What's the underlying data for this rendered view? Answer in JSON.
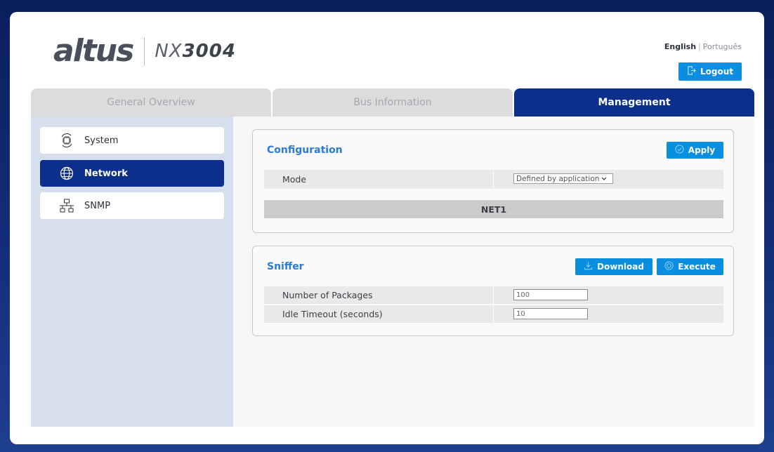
{
  "header": {
    "logo_word": "altus",
    "model_prefix": "NX",
    "model_number": "3004",
    "languages": [
      "English",
      "Português"
    ],
    "logout_label": "Logout"
  },
  "tabs": [
    {
      "label": "General Overview",
      "active": false
    },
    {
      "label": "Bus Information",
      "active": false
    },
    {
      "label": "Management",
      "active": true
    }
  ],
  "sidebar": {
    "items": [
      {
        "label": "System",
        "icon": "chip-icon",
        "active": false
      },
      {
        "label": "Network",
        "icon": "globe-icon",
        "active": true
      },
      {
        "label": "SNMP",
        "icon": "network-tree-icon",
        "active": false
      }
    ]
  },
  "configuration": {
    "title": "Configuration",
    "apply_label": "Apply",
    "mode_label": "Mode",
    "mode_value": "Defined by application",
    "net_label": "NET1"
  },
  "sniffer": {
    "title": "Sniffer",
    "download_label": "Download",
    "execute_label": "Execute",
    "packages_label": "Number of Packages",
    "packages_value": "100",
    "timeout_label": "Idle Timeout (seconds)",
    "timeout_value": "10"
  },
  "colors": {
    "primary_dark": "#0b2f8a",
    "accent_blue": "#0a8ee0",
    "title_blue": "#2a7ad6",
    "sidebar_bg": "#d6dfee"
  }
}
